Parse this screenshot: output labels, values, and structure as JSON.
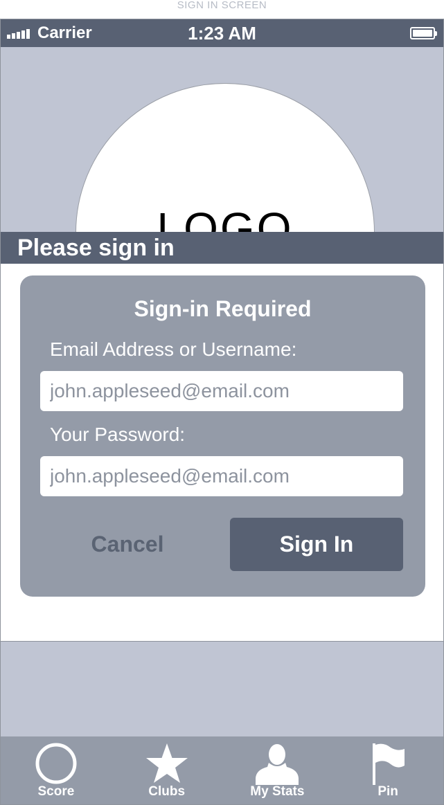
{
  "caption": "SIGN IN SCREEN",
  "status_bar": {
    "carrier": "Carrier",
    "time": "1:23 AM"
  },
  "logo": {
    "text": "LOGO"
  },
  "header": {
    "title": "Please sign in"
  },
  "dialog": {
    "title": "Sign-in Required",
    "email_label": "Email Address or Username:",
    "email_placeholder": "john.appleseed@email.com",
    "password_label": "Your Password:",
    "password_placeholder": "john.appleseed@email.com",
    "cancel_label": "Cancel",
    "signin_label": "Sign In"
  },
  "tabs": [
    {
      "label": "Score",
      "icon": "circle-icon"
    },
    {
      "label": "Clubs",
      "icon": "star-icon"
    },
    {
      "label": "My Stats",
      "icon": "person-icon"
    },
    {
      "label": "Pin",
      "icon": "flag-icon"
    }
  ],
  "colors": {
    "bar": "#586173",
    "background": "#c0c5d3",
    "dialog": "#949ba8",
    "tab_bar": "#949ba8"
  }
}
